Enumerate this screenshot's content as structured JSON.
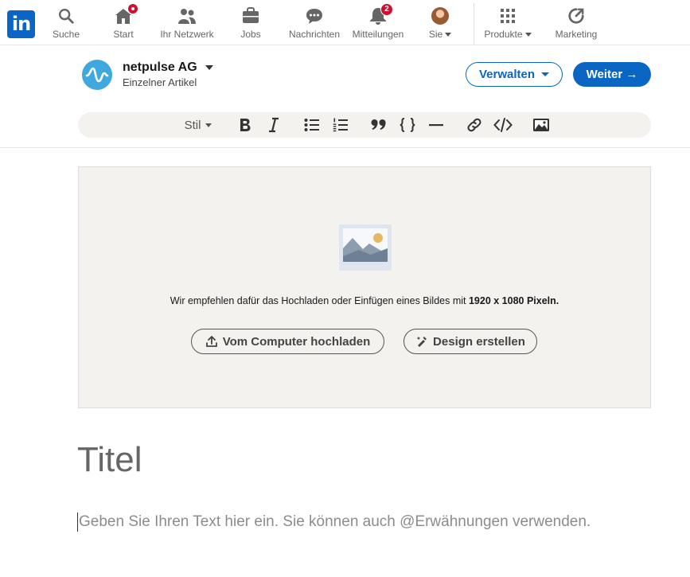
{
  "nav": {
    "logo_text": "in",
    "items": [
      {
        "label": "Suche",
        "icon": "search-icon"
      },
      {
        "label": "Start",
        "icon": "home-icon",
        "badge": ""
      },
      {
        "label": "Ihr Netzwerk",
        "icon": "network-icon"
      },
      {
        "label": "Jobs",
        "icon": "briefcase-icon"
      },
      {
        "label": "Nachrichten",
        "icon": "messaging-icon"
      },
      {
        "label": "Mitteilungen",
        "icon": "bell-icon",
        "badge": "2"
      },
      {
        "label": "Sie",
        "icon": "avatar"
      },
      {
        "label": "Produkte",
        "icon": "grid-icon"
      },
      {
        "label": "Marketing",
        "icon": "marketing-icon"
      }
    ]
  },
  "editor": {
    "org_name": "netpulse AG",
    "org_subtitle": "Einzelner Artikel",
    "manage_label": "Verwalten",
    "next_label": "Weiter →"
  },
  "toolbar": {
    "style_label": "Stil"
  },
  "cover": {
    "hint_prefix": "Wir empfehlen dafür das Hochladen oder Einfügen eines Bildes mit ",
    "hint_bold": "1920 x 1080 Pixeln.",
    "upload_label": "Vom Computer hochladen",
    "design_label": "Design erstellen"
  },
  "article": {
    "title_placeholder": "Titel",
    "body_placeholder": "Geben Sie Ihren Text hier ein. Sie können auch @Erwähnungen verwenden."
  },
  "colors": {
    "brand_blue": "#0a66c2",
    "badge_red": "#cb112d",
    "canvas_beige": "#f3f2ef"
  }
}
